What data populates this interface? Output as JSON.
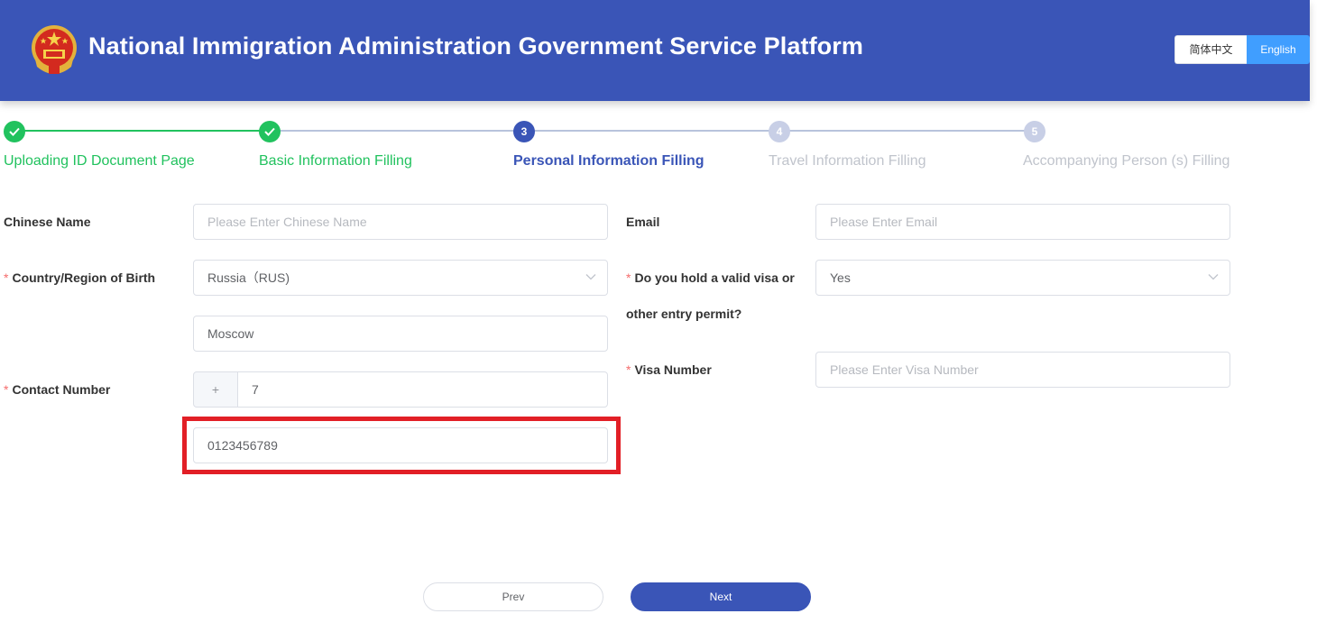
{
  "header": {
    "title": "National Immigration Administration Government Service Platform",
    "lang_zh": "简体中文",
    "lang_en": "English"
  },
  "steps": [
    {
      "label": "Uploading ID Document Page",
      "state": "done"
    },
    {
      "label": "Basic Information Filling",
      "state": "done"
    },
    {
      "label": "Personal Information Filling",
      "state": "active",
      "number": "3"
    },
    {
      "label": "Travel Information Filling",
      "state": "pending",
      "number": "4"
    },
    {
      "label": "Accompanying Person (s) Filling",
      "state": "pending",
      "number": "5"
    }
  ],
  "form": {
    "chinese_name": {
      "label": "Chinese Name",
      "placeholder": "Please Enter Chinese Name"
    },
    "email": {
      "label": "Email",
      "placeholder": "Please Enter Email"
    },
    "birth_country": {
      "label": "Country/Region of Birth",
      "value": "Russia（RUS)"
    },
    "birth_city": {
      "value": "Moscow"
    },
    "visa_hold": {
      "label_line1": "Do you hold a valid visa or",
      "label_line2": "other entry permit?",
      "value": "Yes"
    },
    "visa_number": {
      "label": "Visa Number",
      "placeholder": "Please Enter Visa Number"
    },
    "contact": {
      "label": "Contact Number",
      "prefix": "+",
      "country_code": "7",
      "number": "0123456789"
    },
    "required_mark": "*"
  },
  "buttons": {
    "prev": "Prev",
    "next": "Next"
  },
  "colors": {
    "header_bg": "#3a55b7",
    "done": "#21c25e",
    "active": "#3a55b7",
    "pending": "#c0c4cc",
    "highlight": "#e21f26",
    "lang_active": "#409eff"
  }
}
